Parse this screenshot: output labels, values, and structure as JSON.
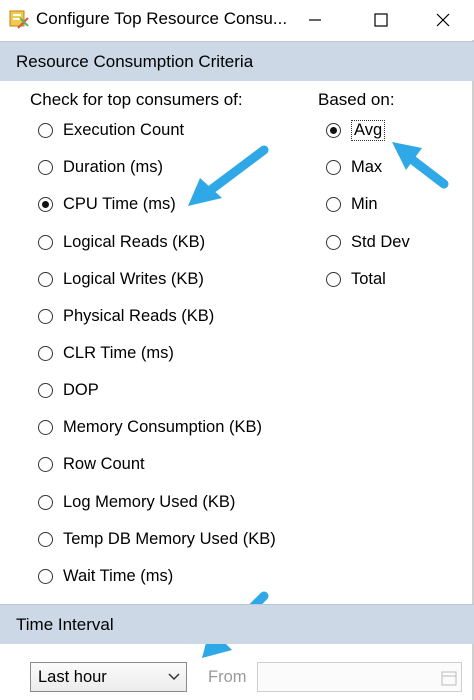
{
  "window": {
    "title": "Configure Top Resource Consu...",
    "icon": "configure-wand-icon",
    "controls": [
      "minimize-icon",
      "maximize-icon",
      "close-icon"
    ]
  },
  "criteria": {
    "header": "Resource Consumption Criteria",
    "consumers_title": "Check for top consumers of:",
    "based_on_title": "Based on:",
    "consumers": [
      {
        "label": "Execution Count",
        "selected": false
      },
      {
        "label": "Duration (ms)",
        "selected": false
      },
      {
        "label": "CPU Time (ms)",
        "selected": true
      },
      {
        "label": "Logical Reads (KB)",
        "selected": false
      },
      {
        "label": "Logical Writes (KB)",
        "selected": false
      },
      {
        "label": "Physical Reads (KB)",
        "selected": false
      },
      {
        "label": "CLR Time (ms)",
        "selected": false
      },
      {
        "label": "DOP",
        "selected": false
      },
      {
        "label": "Memory Consumption (KB)",
        "selected": false
      },
      {
        "label": "Row Count",
        "selected": false
      },
      {
        "label": "Log Memory Used (KB)",
        "selected": false
      },
      {
        "label": "Temp DB Memory Used (KB)",
        "selected": false
      },
      {
        "label": "Wait Time (ms)",
        "selected": false
      }
    ],
    "based_on": [
      {
        "label": "Avg",
        "selected": true
      },
      {
        "label": "Max",
        "selected": false
      },
      {
        "label": "Min",
        "selected": false
      },
      {
        "label": "Std Dev",
        "selected": false
      },
      {
        "label": "Total",
        "selected": false
      }
    ]
  },
  "interval": {
    "header": "Time Interval",
    "select_value": "Last hour",
    "from_label": "From",
    "from_value": ""
  },
  "colors": {
    "header_bg": "#cdd8e6",
    "annotation_arrow": "#2ea8e6"
  }
}
